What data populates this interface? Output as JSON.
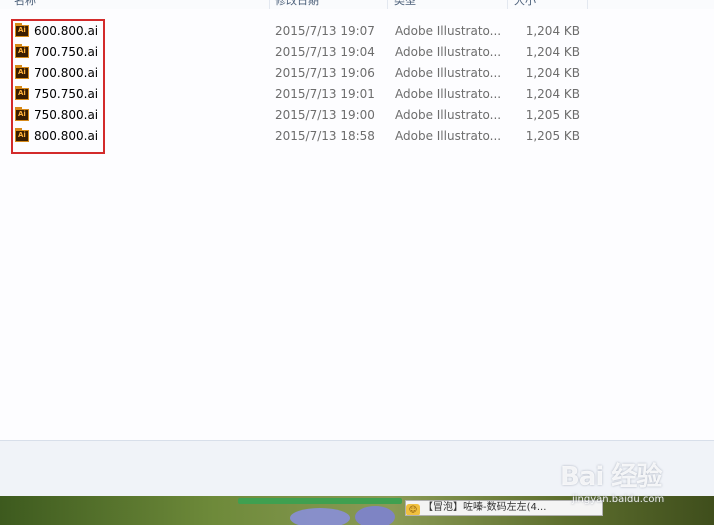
{
  "columns": {
    "name": "名称",
    "date": "修改日期",
    "type": "类型",
    "size": "大小"
  },
  "files": [
    {
      "name": "600.800.ai",
      "date": "2015/7/13 19:07",
      "type": "Adobe Illustrato...",
      "size": "1,204 KB"
    },
    {
      "name": "700.750.ai",
      "date": "2015/7/13 19:04",
      "type": "Adobe Illustrato...",
      "size": "1,204 KB"
    },
    {
      "name": "700.800.ai",
      "date": "2015/7/13 19:06",
      "type": "Adobe Illustrato...",
      "size": "1,204 KB"
    },
    {
      "name": "750.750.ai",
      "date": "2015/7/13 19:01",
      "type": "Adobe Illustrato...",
      "size": "1,204 KB"
    },
    {
      "name": "750.800.ai",
      "date": "2015/7/13 19:00",
      "type": "Adobe Illustrato...",
      "size": "1,205 KB"
    },
    {
      "name": "800.800.ai",
      "date": "2015/7/13 18:58",
      "type": "Adobe Illustrato...",
      "size": "1,205 KB"
    }
  ],
  "file_icon": {
    "name": "adobe-illustrator-file-icon",
    "glyph": "Ai"
  },
  "taskbar": {
    "notification": "【冒泡】咗嗪-数码左左(4..."
  },
  "watermark": {
    "logo": "Bai 经验",
    "sub": "jingyan.baidu.com"
  },
  "colors": {
    "highlight_border": "#d32b2b",
    "secondary_text": "#6d6d6d",
    "header_text": "#4c607a"
  }
}
